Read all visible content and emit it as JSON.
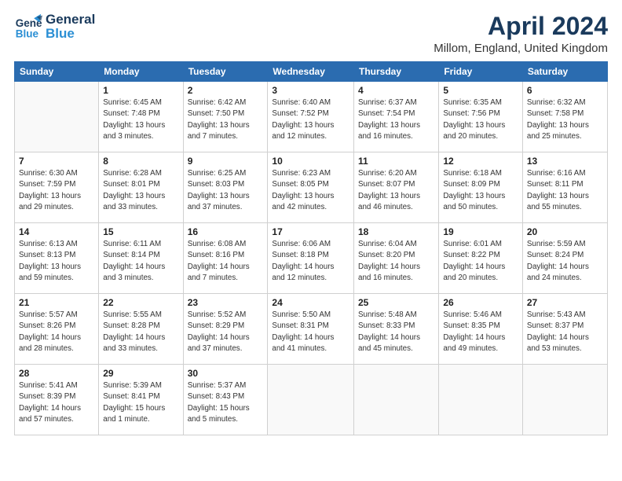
{
  "header": {
    "logo_line1": "General",
    "logo_line2": "Blue",
    "title": "April 2024",
    "location": "Millom, England, United Kingdom"
  },
  "days_of_week": [
    "Sunday",
    "Monday",
    "Tuesday",
    "Wednesday",
    "Thursday",
    "Friday",
    "Saturday"
  ],
  "weeks": [
    [
      {
        "day": "",
        "info": ""
      },
      {
        "day": "1",
        "info": "Sunrise: 6:45 AM\nSunset: 7:48 PM\nDaylight: 13 hours\nand 3 minutes."
      },
      {
        "day": "2",
        "info": "Sunrise: 6:42 AM\nSunset: 7:50 PM\nDaylight: 13 hours\nand 7 minutes."
      },
      {
        "day": "3",
        "info": "Sunrise: 6:40 AM\nSunset: 7:52 PM\nDaylight: 13 hours\nand 12 minutes."
      },
      {
        "day": "4",
        "info": "Sunrise: 6:37 AM\nSunset: 7:54 PM\nDaylight: 13 hours\nand 16 minutes."
      },
      {
        "day": "5",
        "info": "Sunrise: 6:35 AM\nSunset: 7:56 PM\nDaylight: 13 hours\nand 20 minutes."
      },
      {
        "day": "6",
        "info": "Sunrise: 6:32 AM\nSunset: 7:58 PM\nDaylight: 13 hours\nand 25 minutes."
      }
    ],
    [
      {
        "day": "7",
        "info": "Sunrise: 6:30 AM\nSunset: 7:59 PM\nDaylight: 13 hours\nand 29 minutes."
      },
      {
        "day": "8",
        "info": "Sunrise: 6:28 AM\nSunset: 8:01 PM\nDaylight: 13 hours\nand 33 minutes."
      },
      {
        "day": "9",
        "info": "Sunrise: 6:25 AM\nSunset: 8:03 PM\nDaylight: 13 hours\nand 37 minutes."
      },
      {
        "day": "10",
        "info": "Sunrise: 6:23 AM\nSunset: 8:05 PM\nDaylight: 13 hours\nand 42 minutes."
      },
      {
        "day": "11",
        "info": "Sunrise: 6:20 AM\nSunset: 8:07 PM\nDaylight: 13 hours\nand 46 minutes."
      },
      {
        "day": "12",
        "info": "Sunrise: 6:18 AM\nSunset: 8:09 PM\nDaylight: 13 hours\nand 50 minutes."
      },
      {
        "day": "13",
        "info": "Sunrise: 6:16 AM\nSunset: 8:11 PM\nDaylight: 13 hours\nand 55 minutes."
      }
    ],
    [
      {
        "day": "14",
        "info": "Sunrise: 6:13 AM\nSunset: 8:13 PM\nDaylight: 13 hours\nand 59 minutes."
      },
      {
        "day": "15",
        "info": "Sunrise: 6:11 AM\nSunset: 8:14 PM\nDaylight: 14 hours\nand 3 minutes."
      },
      {
        "day": "16",
        "info": "Sunrise: 6:08 AM\nSunset: 8:16 PM\nDaylight: 14 hours\nand 7 minutes."
      },
      {
        "day": "17",
        "info": "Sunrise: 6:06 AM\nSunset: 8:18 PM\nDaylight: 14 hours\nand 12 minutes."
      },
      {
        "day": "18",
        "info": "Sunrise: 6:04 AM\nSunset: 8:20 PM\nDaylight: 14 hours\nand 16 minutes."
      },
      {
        "day": "19",
        "info": "Sunrise: 6:01 AM\nSunset: 8:22 PM\nDaylight: 14 hours\nand 20 minutes."
      },
      {
        "day": "20",
        "info": "Sunrise: 5:59 AM\nSunset: 8:24 PM\nDaylight: 14 hours\nand 24 minutes."
      }
    ],
    [
      {
        "day": "21",
        "info": "Sunrise: 5:57 AM\nSunset: 8:26 PM\nDaylight: 14 hours\nand 28 minutes."
      },
      {
        "day": "22",
        "info": "Sunrise: 5:55 AM\nSunset: 8:28 PM\nDaylight: 14 hours\nand 33 minutes."
      },
      {
        "day": "23",
        "info": "Sunrise: 5:52 AM\nSunset: 8:29 PM\nDaylight: 14 hours\nand 37 minutes."
      },
      {
        "day": "24",
        "info": "Sunrise: 5:50 AM\nSunset: 8:31 PM\nDaylight: 14 hours\nand 41 minutes."
      },
      {
        "day": "25",
        "info": "Sunrise: 5:48 AM\nSunset: 8:33 PM\nDaylight: 14 hours\nand 45 minutes."
      },
      {
        "day": "26",
        "info": "Sunrise: 5:46 AM\nSunset: 8:35 PM\nDaylight: 14 hours\nand 49 minutes."
      },
      {
        "day": "27",
        "info": "Sunrise: 5:43 AM\nSunset: 8:37 PM\nDaylight: 14 hours\nand 53 minutes."
      }
    ],
    [
      {
        "day": "28",
        "info": "Sunrise: 5:41 AM\nSunset: 8:39 PM\nDaylight: 14 hours\nand 57 minutes."
      },
      {
        "day": "29",
        "info": "Sunrise: 5:39 AM\nSunset: 8:41 PM\nDaylight: 15 hours\nand 1 minute."
      },
      {
        "day": "30",
        "info": "Sunrise: 5:37 AM\nSunset: 8:43 PM\nDaylight: 15 hours\nand 5 minutes."
      },
      {
        "day": "",
        "info": ""
      },
      {
        "day": "",
        "info": ""
      },
      {
        "day": "",
        "info": ""
      },
      {
        "day": "",
        "info": ""
      }
    ]
  ]
}
